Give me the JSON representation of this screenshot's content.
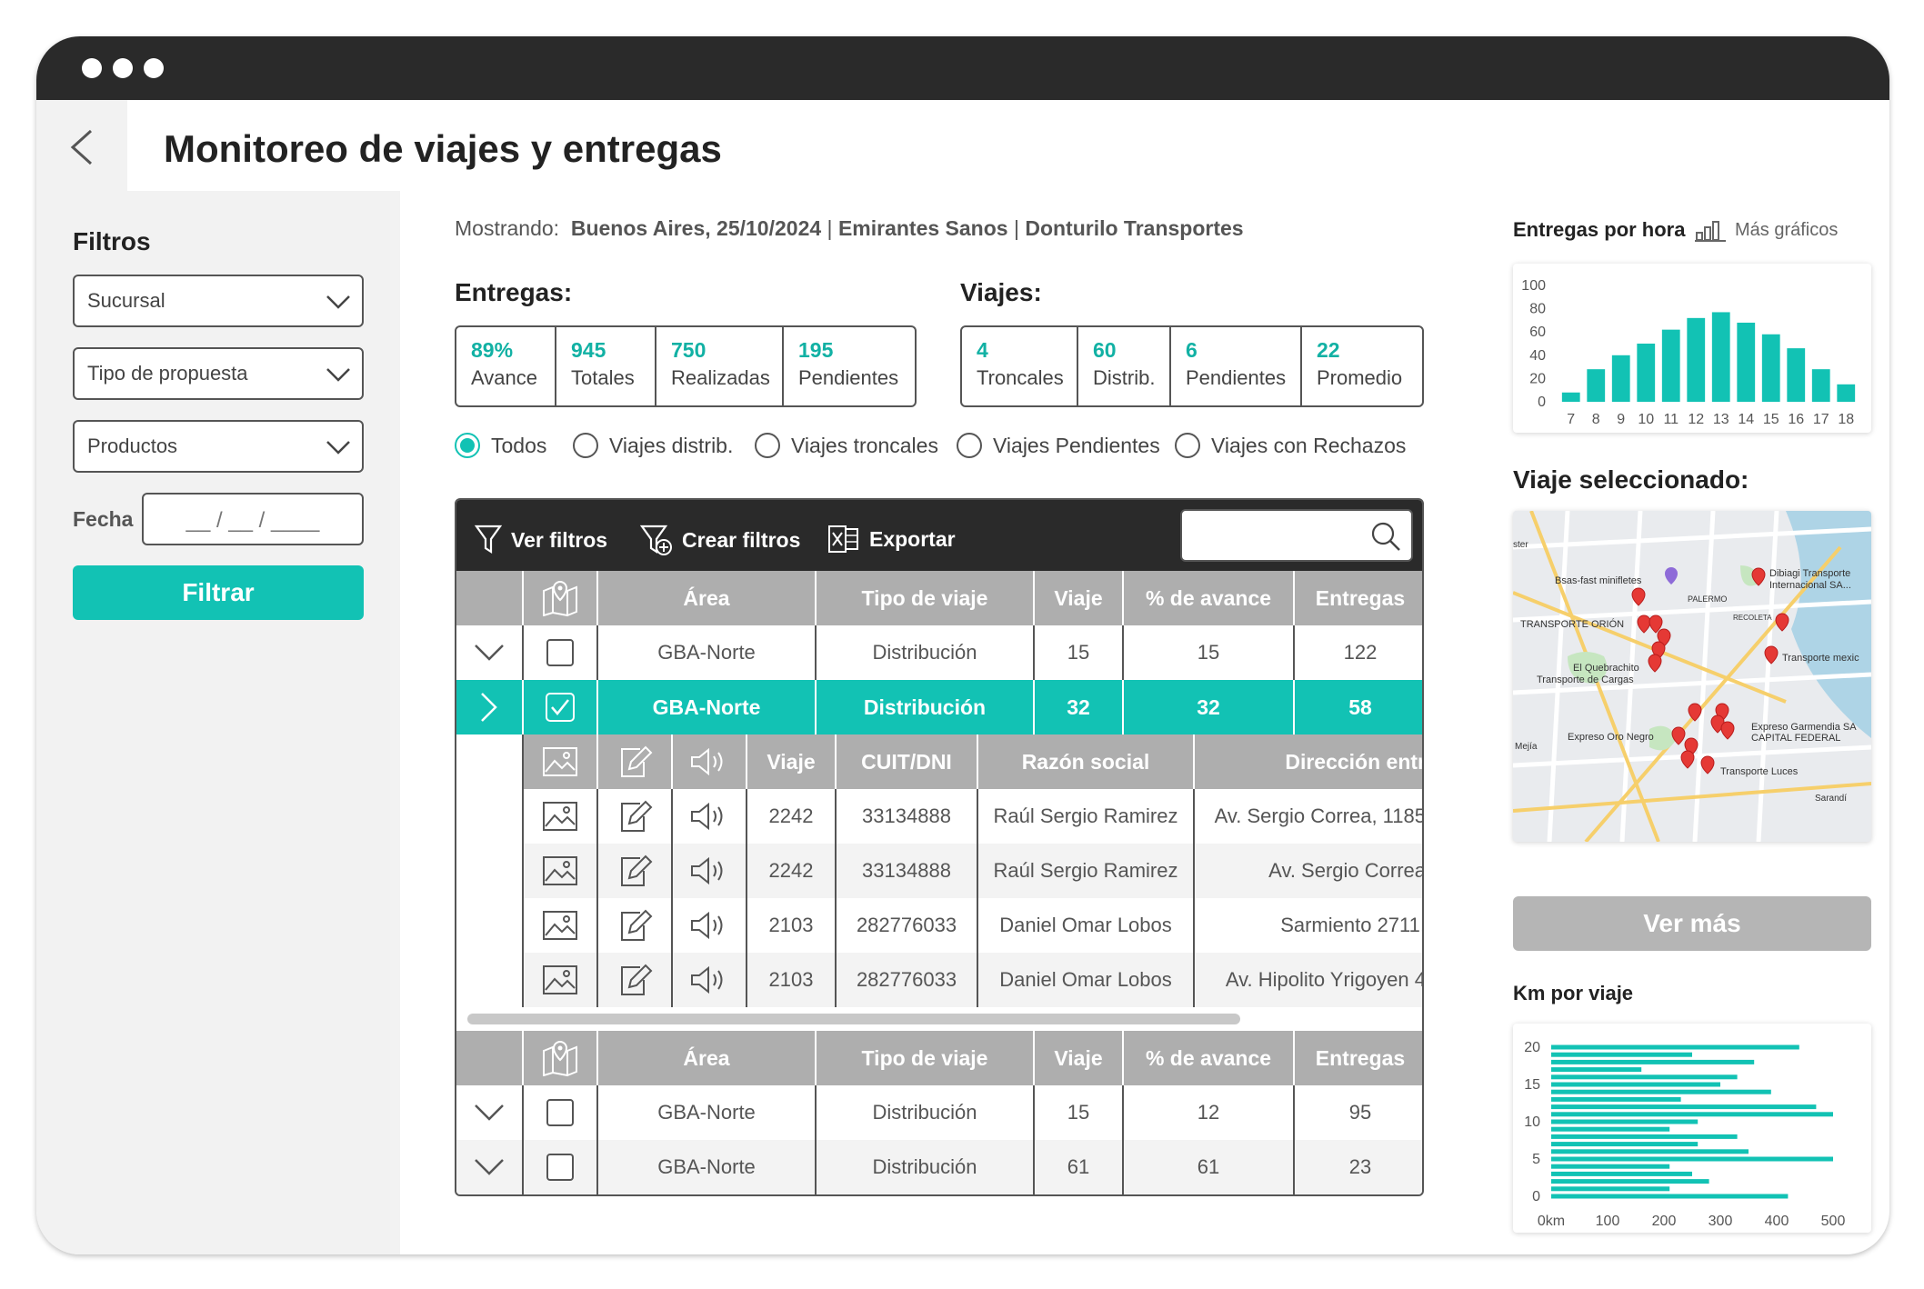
{
  "page": {
    "title": "Monitoreo de viajes y entregas"
  },
  "sidebar": {
    "title": "Filtros",
    "selects": [
      {
        "label": "Sucursal"
      },
      {
        "label": "Tipo de propuesta"
      },
      {
        "label": "Productos"
      }
    ],
    "date": {
      "label": "Fecha",
      "placeholder": "__ / __ / ____"
    },
    "filter_button": "Filtrar"
  },
  "showing": {
    "prefix": "Mostrando:",
    "city": "Buenos Aires",
    "date": "25/10/2024",
    "company1": "Emirantes Sanos",
    "company2": "Donturilo Transportes"
  },
  "entregas": {
    "title": "Entregas:",
    "kpis": [
      {
        "value": "89%",
        "label": "Avance"
      },
      {
        "value": "945",
        "label": "Totales"
      },
      {
        "value": "750",
        "label": "Realizadas"
      },
      {
        "value": "195",
        "label": "Pendientes"
      }
    ]
  },
  "viajes": {
    "title": "Viajes:",
    "kpis": [
      {
        "value": "4",
        "label": "Troncales"
      },
      {
        "value": "60",
        "label": "Distrib."
      },
      {
        "value": "6",
        "label": "Pendientes"
      },
      {
        "value": "22",
        "label": "Promedio"
      }
    ]
  },
  "radios": [
    {
      "label": "Todos",
      "selected": true
    },
    {
      "label": "Viajes distrib.",
      "selected": false
    },
    {
      "label": "Viajes troncales",
      "selected": false
    },
    {
      "label": "Viajes Pendientes",
      "selected": false
    },
    {
      "label": "Viajes con Rechazos",
      "selected": false
    }
  ],
  "toolbar": {
    "ver_filtros": "Ver filtros",
    "crear_filtros": "Crear filtros",
    "exportar": "Exportar"
  },
  "table": {
    "headers": [
      "Área",
      "Tipo de viaje",
      "Viaje",
      "% de avance",
      "Entregas"
    ],
    "rows": [
      {
        "area": "GBA-Norte",
        "tipo": "Distribución",
        "viaje": "15",
        "avance": "15",
        "entregas": "122",
        "expanded": false,
        "checked": false
      },
      {
        "area": "GBA-Norte",
        "tipo": "Distribución",
        "viaje": "32",
        "avance": "32",
        "entregas": "58",
        "expanded": true,
        "checked": true
      }
    ],
    "sub_headers": [
      "Viaje",
      "CUIT/DNI",
      "Razón social",
      "Dirección entr"
    ],
    "sub_rows": [
      {
        "viaje": "2242",
        "cuit": "33134888",
        "razon": "Raúl Sergio Ramirez",
        "direccion": "Av. Sergio Correa, 1185"
      },
      {
        "viaje": "2242",
        "cuit": "33134888",
        "razon": "Raúl Sergio Ramirez",
        "direccion": "Av. Sergio Correa"
      },
      {
        "viaje": "2103",
        "cuit": "282776033",
        "razon": "Daniel Omar Lobos",
        "direccion": "Sarmiento 2711,"
      },
      {
        "viaje": "2103",
        "cuit": "282776033",
        "razon": "Daniel Omar Lobos",
        "direccion": "Av. Hipolito Yrigoyen 4"
      }
    ],
    "rows2": [
      {
        "area": "GBA-Norte",
        "tipo": "Distribución",
        "viaje": "15",
        "avance": "12",
        "entregas": "95"
      },
      {
        "area": "GBA-Norte",
        "tipo": "Distribución",
        "viaje": "61",
        "avance": "61",
        "entregas": "23"
      }
    ]
  },
  "right": {
    "entregas_hora_title": "Entregas por hora",
    "mas_graficos": "Más gráficos",
    "viaje_sel_title": "Viaje seleccionado:",
    "ver_mas": "Ver más",
    "km_title": "Km por viaje",
    "map_labels": [
      "Bsas-fast minifletes",
      "Dibiagi Transporte",
      "Internacional SA...",
      "PALERMO",
      "RECOLETA",
      "TRANSPORTE ORIÓN",
      "El Quebrachito",
      "Transporte de Cargas",
      "Transporte mexic",
      "Expreso Oro Negro",
      "Expreso Garmendia SA",
      "CAPITAL FEDERAL",
      "Transporte Luces",
      "Mejía",
      "Sarandí",
      "ster"
    ]
  },
  "chart_data": [
    {
      "type": "bar",
      "title": "Entregas por hora",
      "categories": [
        "7",
        "8",
        "9",
        "10",
        "11",
        "12",
        "13",
        "14",
        "15",
        "16",
        "17",
        "18"
      ],
      "values": [
        8,
        28,
        40,
        50,
        62,
        72,
        77,
        68,
        58,
        46,
        28,
        15
      ],
      "ylim": [
        0,
        100
      ],
      "yticks": [
        0,
        20,
        40,
        60,
        80,
        100
      ]
    },
    {
      "type": "bar",
      "orientation": "horizontal",
      "title": "Km por viaje",
      "values": [
        440,
        250,
        360,
        160,
        330,
        300,
        390,
        230,
        470,
        500,
        260,
        210,
        330,
        260,
        350,
        500,
        210,
        250,
        280,
        210,
        420
      ],
      "xlim": [
        0,
        500
      ],
      "xticks": [
        "0km",
        "100",
        "200",
        "300",
        "400",
        "500"
      ],
      "yticks": [
        0,
        5,
        10,
        15,
        20
      ]
    }
  ],
  "colors": {
    "accent": "#12c2b4",
    "dark": "#2a2a2a",
    "header_gray": "#aeaeae",
    "pin_red": "#e53935"
  }
}
